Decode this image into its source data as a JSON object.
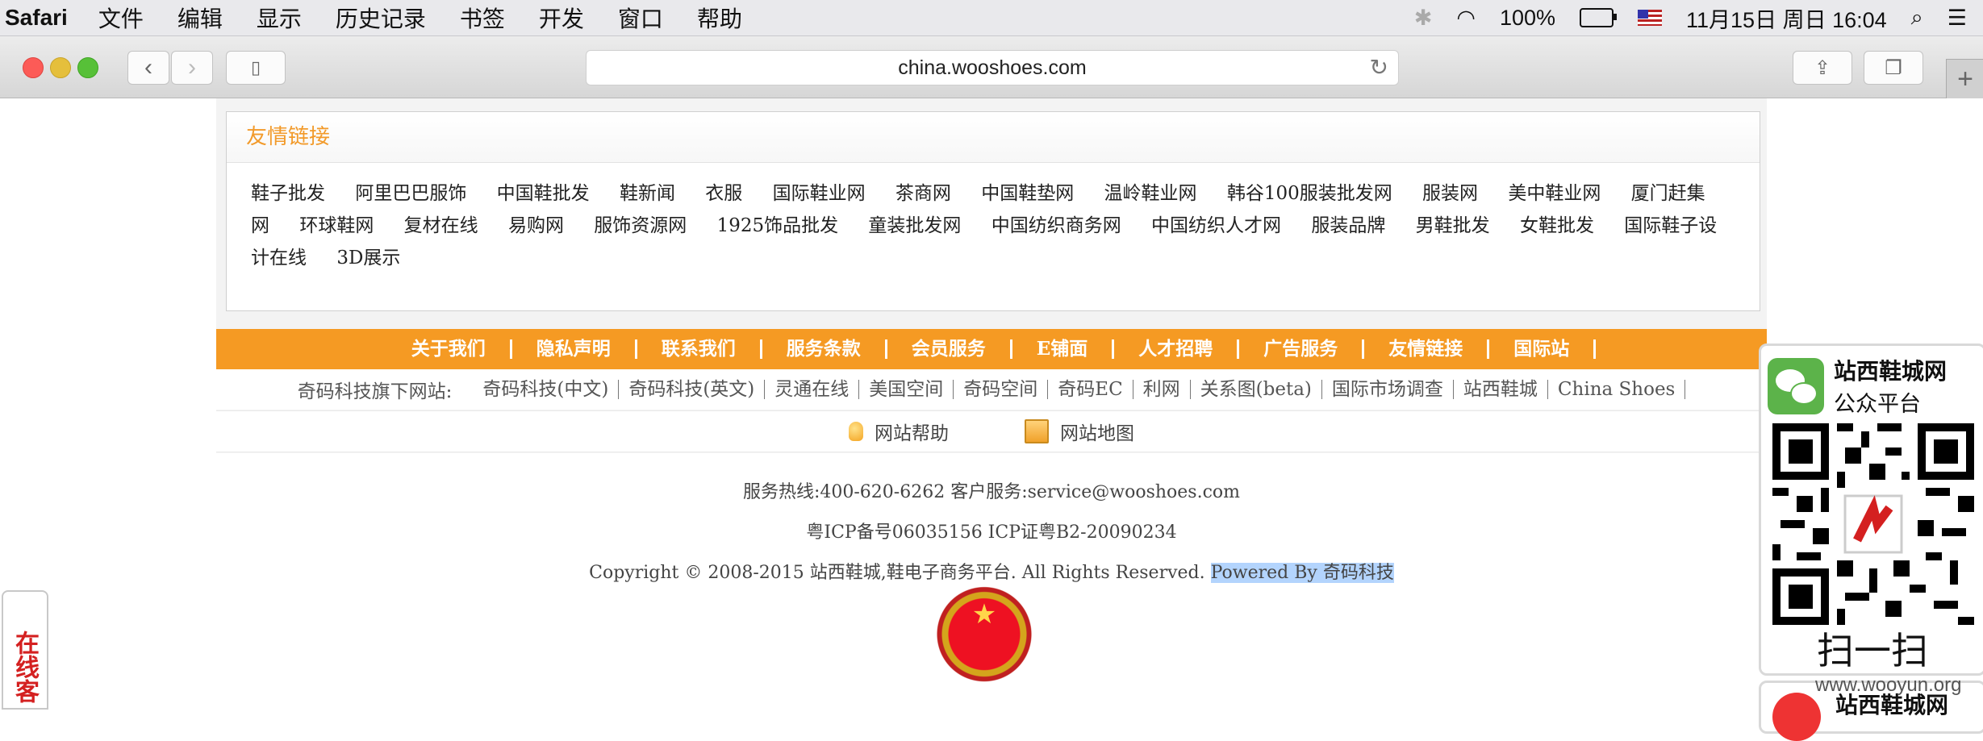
{
  "menubar": {
    "app": "Safari",
    "items": [
      "文件",
      "编辑",
      "显示",
      "历史记录",
      "书签",
      "开发",
      "窗口",
      "帮助"
    ],
    "battery": "100%",
    "datetime": "11月15日 周日 16:04"
  },
  "browser": {
    "url": "china.wooshoes.com"
  },
  "friend_links": {
    "title": "友情链接",
    "items": [
      "鞋子批发",
      "阿里巴巴服饰",
      "中国鞋批发",
      "鞋新闻",
      "衣服",
      "国际鞋业网",
      "茶商网",
      "中国鞋垫网",
      "温岭鞋业网",
      "韩谷100服装批发网",
      "服装网",
      "美中鞋业网",
      "厦门赶集网",
      "环球鞋网",
      "复材在线",
      "易购网",
      "服饰资源网",
      "1925饰品批发",
      "童装批发网",
      "中国纺织商务网",
      "中国纺织人才网",
      "服装品牌",
      "男鞋批发",
      "女鞋批发",
      "国际鞋子设计在线",
      "3D展示"
    ]
  },
  "nav": {
    "items": [
      "关于我们",
      "隐私声明",
      "联系我们",
      "服务条款",
      "会员服务",
      "E铺面",
      "人才招聘",
      "广告服务",
      "友情链接",
      "国际站"
    ]
  },
  "sites": {
    "prefix": "奇码科技旗下网站:",
    "items": [
      "奇码科技(中文)",
      "奇码科技(英文)",
      "灵通在线",
      "美国空间",
      "奇码空间",
      "奇码EC",
      "利网",
      "关系图(beta)",
      "国际市场调查",
      "站西鞋城",
      "China Shoes"
    ]
  },
  "help": {
    "help_label": "网站帮助",
    "sitemap_label": "网站地图"
  },
  "footer": {
    "hotline": "服务热线:400-620-6262 客户服务:service@wooshoes.com",
    "icp": "粤ICP备号06035156 ICP证粤B2-20090234",
    "copyright": "Copyright © 2008-2015 站西鞋城,鞋电子商务平台. All Rights Reserved.",
    "powered": "Powered By 奇码科技"
  },
  "widgets": {
    "online_service": "在线客",
    "wechat_title": "站西鞋城网",
    "wechat_subtitle": "公众平台",
    "scan": "扫一扫",
    "second_title": "站西鞋城网",
    "watermark": "www.wooyun.org"
  },
  "colors": {
    "accent_orange": "#f59a23",
    "link_orange": "#f29a2a",
    "selection": "#b3d4fd"
  }
}
